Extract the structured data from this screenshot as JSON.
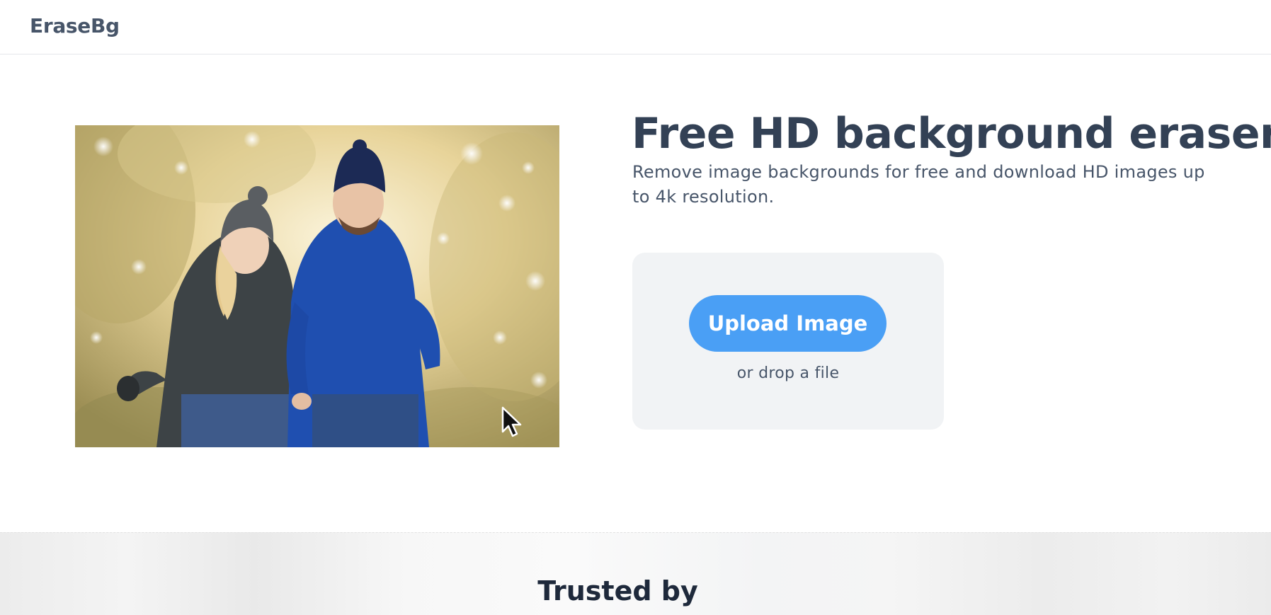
{
  "header": {
    "logo_text": "EraseBg"
  },
  "hero": {
    "image_alt": "Couple in winter jackets and beanies walking together",
    "headline": "Free HD background eraser",
    "subheadline": "Remove image backgrounds for free and download HD images up to 4k resolution."
  },
  "upload": {
    "button_label": "Upload Image",
    "drop_hint": "or drop a file"
  },
  "trusted": {
    "title": "Trusted by"
  },
  "colors": {
    "accent": "#4a9ff5",
    "heading": "#334155",
    "card_background": "#f1f3f5"
  },
  "icons": {
    "cursor": "mouse-pointer-icon"
  }
}
